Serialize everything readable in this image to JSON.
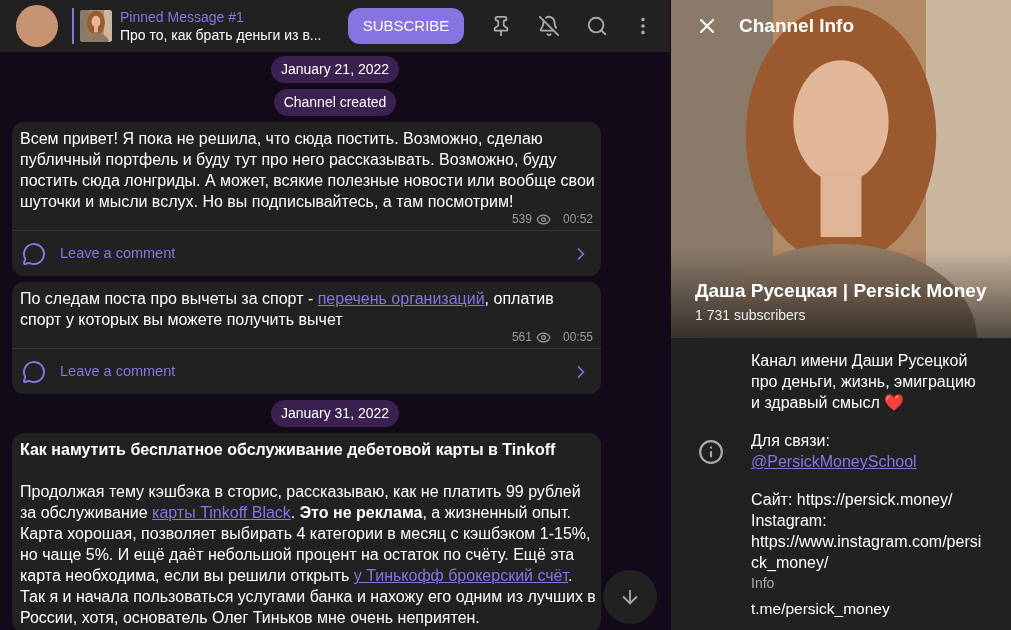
{
  "header": {
    "pinned": {
      "title": "Pinned Message #1",
      "text": "Про то, как брать деньги из в..."
    },
    "subscribe": "SUBSCRIBE"
  },
  "chat": [
    {
      "kind": "date",
      "text": "January 21, 2022"
    },
    {
      "kind": "service",
      "text": "Channel created"
    },
    {
      "kind": "post",
      "paragraphs": [
        [
          {
            "kind": "text",
            "text": "Всем привет! Я пока не решила, что сюда постить. Возможно, сделаю публичный портфель и буду тут про него рассказывать. Возможно, буду постить сюда лонгриды. А может, всякие полезные новости или вообще свои шуточки и мысли вслух. Но вы подписывайтесь, а там посмотрим!"
          }
        ]
      ],
      "views": "539",
      "time": "00:52",
      "comment": "Leave a comment"
    },
    {
      "kind": "post",
      "paragraphs": [
        [
          {
            "kind": "text",
            "text": "По следам поста про вычеты за спорт - "
          },
          {
            "kind": "link",
            "text": "перечень организаций"
          },
          {
            "kind": "text",
            "text": ", оплатив спорт у которых вы можете получить вычет"
          }
        ]
      ],
      "views": "561",
      "time": "00:55",
      "comment": "Leave a comment"
    },
    {
      "kind": "date",
      "text": "January 31, 2022"
    },
    {
      "kind": "post",
      "paragraphs": [
        [
          {
            "kind": "bold",
            "text": "Как намутить бесплатное обслуживание дебетовой карты в Tinkoff"
          }
        ],
        [
          {
            "kind": "text",
            "text": "Продолжая тему кэшбэка в сторис, рассказываю, как не платить 99 рублей за обслуживание "
          },
          {
            "kind": "link",
            "text": "карты Tinkoff Black"
          },
          {
            "kind": "text",
            "text": ". "
          },
          {
            "kind": "bold",
            "text": "Это не реклама"
          },
          {
            "kind": "text",
            "text": ", а жизненный опыт. Карта хорошая, позволяет выбирать 4 категории в месяц с кэшбэком 1-15%, но чаще 5%. И ещё даёт небольшой процент на остаток по счёту. Ещё эта карта необходима, если вы решили открыть "
          },
          {
            "kind": "link",
            "text": "у Тинькофф брокерский счёт"
          },
          {
            "kind": "text",
            "text": ". Так я и начала пользоваться услугами банка и нахожу его одним из лучших в России, хотя, основатель Олег Тиньков мне очень неприятен."
          }
        ]
      ]
    }
  ],
  "info_panel": {
    "title": "Channel Info",
    "channel_name": "Даша Русецкая | Persick Money",
    "subscribers": "1 731 subscribers",
    "description": [
      [
        {
          "kind": "text",
          "text": "Канал имени Даши Русецкой про деньги, жизнь, эмиграцию и здравый смысл ❤️"
        }
      ],
      [
        {
          "kind": "text",
          "text": "Для связи:"
        },
        {
          "kind": "break"
        },
        {
          "kind": "link",
          "text": "@PersickMoneySchool"
        }
      ],
      [
        {
          "kind": "text",
          "text": "Сайт: https://persick.money/ Instagram: https://www.instagram.com/persick_money/"
        }
      ]
    ],
    "description_label": "Info",
    "link": "t.me/persick_money"
  }
}
